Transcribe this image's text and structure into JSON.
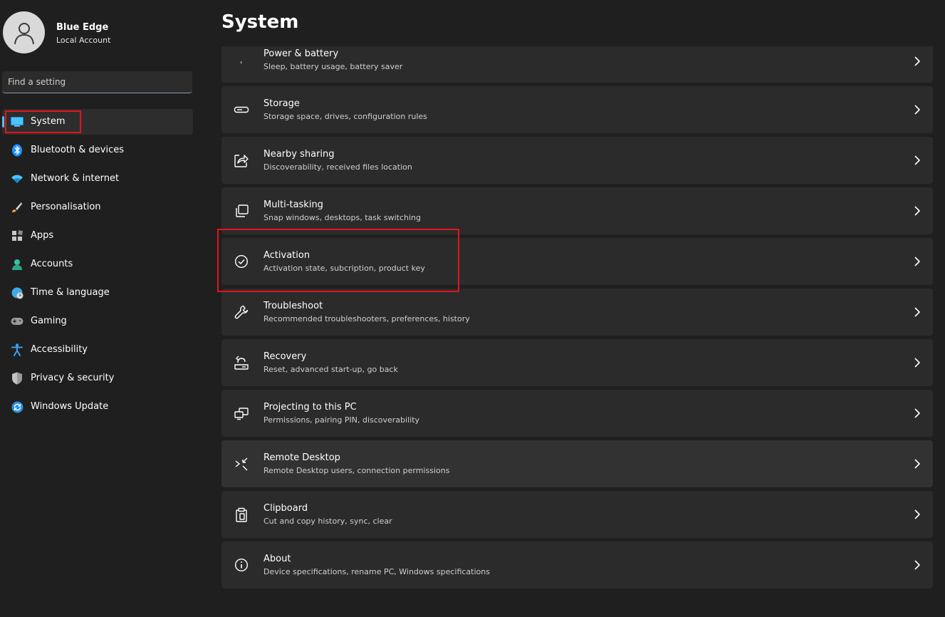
{
  "profile": {
    "name": "Blue Edge",
    "account_type": "Local Account"
  },
  "search": {
    "placeholder": "Find a setting"
  },
  "sidebar": {
    "items": [
      {
        "label": "System",
        "icon": "system-display-icon"
      },
      {
        "label": "Bluetooth & devices",
        "icon": "bluetooth-icon"
      },
      {
        "label": "Network & internet",
        "icon": "wifi-icon"
      },
      {
        "label": "Personalisation",
        "icon": "brush-icon"
      },
      {
        "label": "Apps",
        "icon": "apps-icon"
      },
      {
        "label": "Accounts",
        "icon": "person-icon"
      },
      {
        "label": "Time & language",
        "icon": "globe-clock-icon"
      },
      {
        "label": "Gaming",
        "icon": "gamepad-icon"
      },
      {
        "label": "Accessibility",
        "icon": "accessibility-icon"
      },
      {
        "label": "Privacy & security",
        "icon": "shield-icon"
      },
      {
        "label": "Windows Update",
        "icon": "update-icon"
      }
    ],
    "selected": "System"
  },
  "main": {
    "title": "System",
    "items": [
      {
        "title": "Power & battery",
        "subtitle": "Sleep, battery usage, battery saver",
        "icon": "power-icon"
      },
      {
        "title": "Storage",
        "subtitle": "Storage space, drives, configuration rules",
        "icon": "storage-drive-icon"
      },
      {
        "title": "Nearby sharing",
        "subtitle": "Discoverability, received files location",
        "icon": "share-icon"
      },
      {
        "title": "Multi-tasking",
        "subtitle": "Snap windows, desktops, task switching",
        "icon": "multitasking-icon"
      },
      {
        "title": "Activation",
        "subtitle": "Activation state, subcription, product key",
        "icon": "check-circle-icon"
      },
      {
        "title": "Troubleshoot",
        "subtitle": "Recommended troubleshooters, preferences, history",
        "icon": "wrench-icon"
      },
      {
        "title": "Recovery",
        "subtitle": "Reset, advanced start-up, go back",
        "icon": "recovery-icon"
      },
      {
        "title": "Projecting to this PC",
        "subtitle": "Permissions, pairing PIN, discoverability",
        "icon": "projecting-icon"
      },
      {
        "title": "Remote Desktop",
        "subtitle": "Remote Desktop users, connection permissions",
        "icon": "remote-desktop-icon"
      },
      {
        "title": "Clipboard",
        "subtitle": "Cut and copy history, sync, clear",
        "icon": "clipboard-icon"
      },
      {
        "title": "About",
        "subtitle": "Device specifications, rename PC, Windows specifications",
        "icon": "info-icon"
      }
    ]
  },
  "colors": {
    "accent": "#4cc2ff",
    "highlight": "#e3141c",
    "card_bg": "#2b2b2b",
    "window_bg": "#1f1f1f"
  }
}
